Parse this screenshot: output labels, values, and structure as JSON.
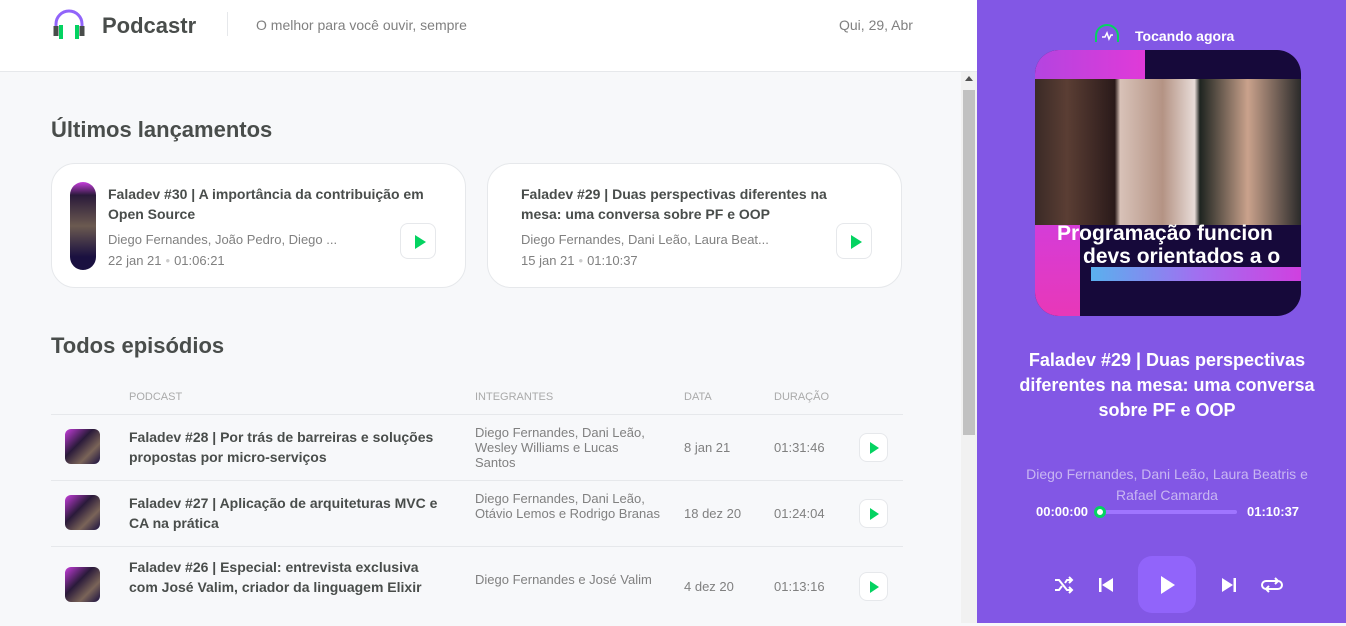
{
  "header": {
    "app_name": "Podcastr",
    "tagline": "O melhor para você ouvir, sempre",
    "date": "Qui, 29, Abr"
  },
  "latest": {
    "heading": "Últimos lançamentos",
    "episodes": [
      {
        "title": "Faladev #30 | A importância da contribuição em Open Source",
        "members": "Diego Fernandes, João Pedro, Diego ...",
        "date": "22 jan 21",
        "duration": "01:06:21"
      },
      {
        "title": "Faladev #29 | Duas perspectivas diferentes na mesa: uma conversa sobre PF e OOP",
        "members": "Diego Fernandes, Dani Leão, Laura Beat...",
        "date": "15 jan 21",
        "duration": "01:10:37"
      }
    ]
  },
  "all": {
    "heading": "Todos episódios",
    "columns": [
      "Podcast",
      "Integrantes",
      "Data",
      "Duração"
    ],
    "episodes": [
      {
        "title": "Faladev #28 | Por trás de barreiras e soluções propostas por micro-serviços",
        "members": "Diego Fernandes, Dani Leão, Wesley Williams e Lucas Santos",
        "date": "8 jan 21",
        "duration": "01:31:46"
      },
      {
        "title": "Faladev #27 | Aplicação de arquiteturas MVC e CA na prática",
        "members": "Diego Fernandes, Dani Leão, Otávio Lemos e Rodrigo Branas",
        "date": "18 dez 20",
        "duration": "01:24:04"
      },
      {
        "title": "Faladev #26 | Especial: entrevista exclusiva com José Valim, criador da linguagem Elixir",
        "members": "Diego Fernandes e José Valim",
        "date": "4 dez 20",
        "duration": "01:13:16"
      }
    ]
  },
  "player": {
    "label": "Tocando agora",
    "cover_text": "Programação funcion\ndevs orientados a o",
    "title": "Faladev #29 | Duas perspectivas diferentes na mesa: uma conversa sobre PF e OOP",
    "members": "Diego Fernandes, Dani Leão, Laura Beatris e Rafael Camarda",
    "current_time": "00:00:00",
    "total_time": "01:10:37",
    "progress": 0
  },
  "colors": {
    "brand": "#8257e5",
    "accent": "#04d361"
  }
}
